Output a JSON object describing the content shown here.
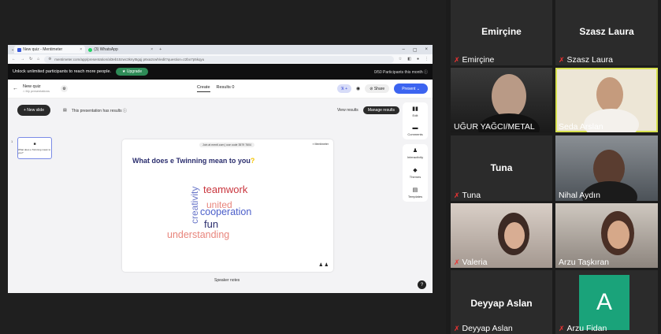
{
  "browser": {
    "tabs": [
      {
        "label": "New quiz - Mentimeter",
        "close": "×"
      },
      {
        "label": "(3) WhatsApp",
        "close": "×"
      }
    ],
    "new_tab": "+",
    "url": "mentimeter.com/app/presentation/al3eb15zwc3knyt5gqj p6xa2cwh/edit?question=z2bo7p5kqyu",
    "window_controls": [
      "–",
      "▢",
      "×"
    ]
  },
  "promo": {
    "text": "Unlock unlimited participants to reach more people.",
    "upgrade_label": "★ Upgrade",
    "participants": "0/50  Participants this month ⓘ"
  },
  "app": {
    "title": "New quiz",
    "subtitle": "My presentations",
    "tabs": {
      "create": "Create",
      "results": "Results",
      "results_count": "0"
    },
    "avatars": "ℜ +",
    "share": "⊘ Share",
    "present": "Present  ⌄"
  },
  "editor": {
    "new_slide": "+ New slide",
    "results_notice": "This presentation has results ⓘ",
    "view_results": "View results",
    "manage_results": "Manage results",
    "thumb_number": "1",
    "thumb_title": "What does e Twinning mean to you?",
    "speaker_notes": "Speaker notes",
    "help": "?"
  },
  "slide": {
    "join_text": "Join at menti.com | use code 3579 7604",
    "logo": "≡ Mentimeter",
    "question_main": "What does e Twinning mean to you",
    "question_mark": "?",
    "words": [
      "teamwork",
      "united",
      "cooperation",
      "creativity",
      "fun",
      "understanding"
    ],
    "footer_icons": "♟ ♟"
  },
  "side_panel": {
    "items": [
      {
        "label": "Edit",
        "glyph": "▮▮"
      },
      {
        "label": "Comments",
        "glyph": "▬"
      },
      {
        "label": "Interactivity",
        "glyph": "♟"
      },
      {
        "label": "Themes",
        "glyph": "◆"
      },
      {
        "label": "Templates",
        "glyph": "▤"
      }
    ]
  },
  "participants": [
    {
      "name": "Emirçine",
      "display": "Emirçine",
      "muted": true
    },
    {
      "name": "Szasz Laura",
      "display": "Szasz Laura",
      "muted": true
    },
    {
      "name": "UĞUR YAĞCI/METAL",
      "muted": false
    },
    {
      "name": "Seda Arslan",
      "muted": false
    },
    {
      "name": "Tuna",
      "display": "Tuna",
      "muted": true
    },
    {
      "name": "Nihal Aydın",
      "muted": false
    },
    {
      "name": "Valeria",
      "muted": true
    },
    {
      "name": "Arzu Taşkıran",
      "muted": false
    },
    {
      "name": "Deyyap Aslan",
      "display": "Deyyap Aslan",
      "muted": true
    },
    {
      "name": "Arzu Fidan",
      "avatar_letter": "A",
      "muted": true
    }
  ],
  "colors": {
    "accent": "#3c64f0",
    "upgrade": "#2e8b57",
    "highlight": "#d8e24f",
    "muted": "#e33333",
    "avatar_bg": "#1aa37a"
  }
}
